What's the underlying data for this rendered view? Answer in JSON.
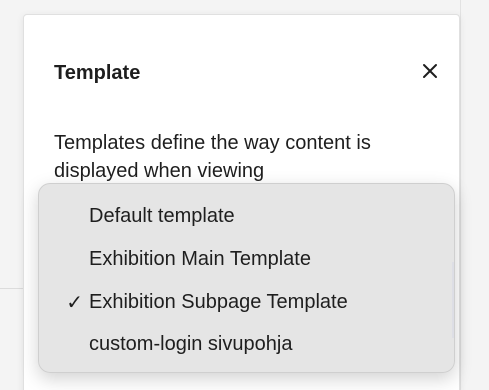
{
  "panel": {
    "title": "Template",
    "close_icon": "close-icon",
    "description": "Templates define the way content is displayed when viewing"
  },
  "dropdown": {
    "options": [
      {
        "label": "Default template",
        "selected": false
      },
      {
        "label": "Exhibition Main Template",
        "selected": false
      },
      {
        "label": "Exhibition Subpage Template",
        "selected": true
      },
      {
        "label": "custom-login sivupohja",
        "selected": false
      }
    ],
    "check_mark": "✓"
  },
  "colors": {
    "accent": "#3858e9",
    "text": "#1e1e1e",
    "dropdown_bg": "#e4e4e4"
  }
}
